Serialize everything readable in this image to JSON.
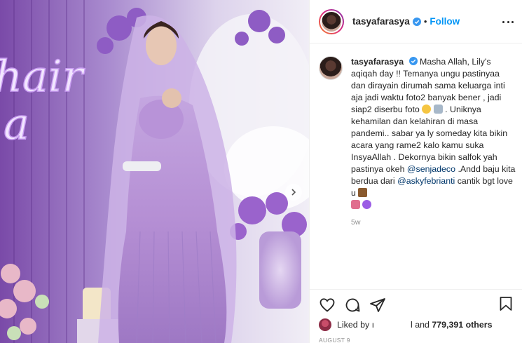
{
  "post": {
    "username": "tasyafarasya",
    "verified": true,
    "separator": "•",
    "follow_label": "Follow",
    "caption_lines": [
      "Masha Allah, Lily's",
      "aqiqah day !! Temanya ungu pastinyaa",
      "dan dirayain dirumah sama keluarga",
      "inti aja jadi waktu foto2 banyak bener",
      ", jadi siap2 diserbu foto",
      ". Uniknya kehamilan dan kelahiran di",
      "masa pandemi.. sabar ya ly someday",
      "kita bikin acara yang rame2 kalo kamu",
      "suka InsyaAllah . Dekornya bikin",
      "salfok yah pastinya okeh",
      ".Andd baju kita berdua dari",
      "cantik bgt love u"
    ],
    "mention_1": "@senjadeco",
    "mention_2": "@askyfebrianti",
    "time_ago": "5w",
    "liked_by_prefix": "Liked by ı",
    "liked_by_suffix": "l and",
    "likes_count": "779,391 others",
    "date": "AUGUST 9"
  },
  "photo": {
    "neon_sign_1": "hair",
    "neon_sign_2": "a"
  },
  "colors": {
    "accent": "#0095f6",
    "mention": "#00376b",
    "lavender": "#b89ad6",
    "purple_deep": "#6b3fa0"
  },
  "icons": [
    "heart-icon",
    "comment-icon",
    "share-icon",
    "bookmark-icon",
    "more-icon",
    "verified-icon",
    "chevron-right-icon"
  ]
}
